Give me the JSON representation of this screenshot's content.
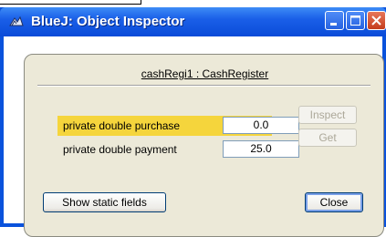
{
  "window": {
    "title": "BlueJ:  Object Inspector"
  },
  "inspector": {
    "object_title": "cashRegi1 : CashRegister",
    "fields": [
      {
        "label": "private double purchase",
        "value": "0.0",
        "selected": true
      },
      {
        "label": "private double payment",
        "value": "25.0",
        "selected": false
      }
    ],
    "inspect_label": "Inspect",
    "get_label": "Get",
    "show_static_label": "Show static fields",
    "close_label": "Close"
  },
  "colors": {
    "titlebar": "#0a52dc",
    "selected_row": "#f5d53c",
    "panel_bg": "#ece9d8"
  }
}
